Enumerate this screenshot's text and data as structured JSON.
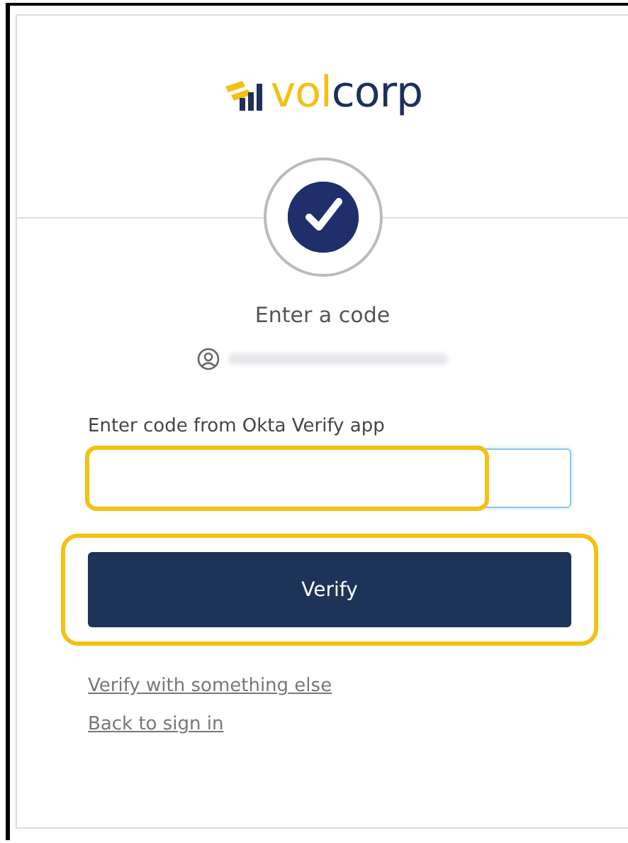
{
  "logo": {
    "accent": "vol",
    "text": "corp"
  },
  "title": "Enter a code",
  "account": {
    "kind": "blurred"
  },
  "code_field": {
    "label": "Enter code from Okta Verify app",
    "focused": true,
    "highlighted": true
  },
  "verify_button": {
    "label": "Verify",
    "highlighted": true
  },
  "links": [
    "Verify with something else",
    "Back to sign in"
  ]
}
